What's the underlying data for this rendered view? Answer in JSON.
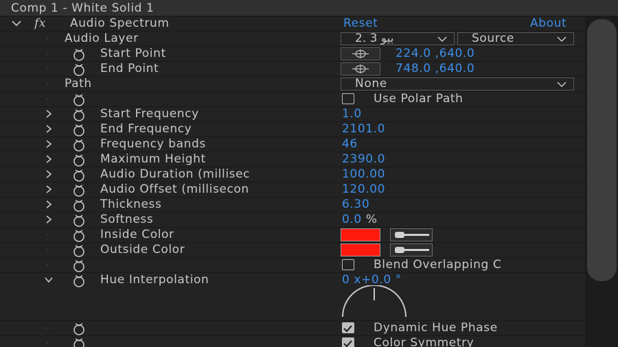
{
  "title": "Comp 1 - White Solid 1",
  "effect": {
    "name": "Audio Spectrum",
    "fx_icon": "fx",
    "reset": "Reset",
    "about": "About"
  },
  "rows": {
    "audio_layer": {
      "label": "Audio Layer",
      "value": "2. 3 بيو",
      "source": "Source"
    },
    "start_point": {
      "label": "Start Point",
      "value": "224.0 ,640.0"
    },
    "end_point": {
      "label": "End Point",
      "value": "748.0 ,640.0"
    },
    "path": {
      "label": "Path",
      "value": "None"
    },
    "use_polar": {
      "value": "Use Polar Path",
      "checked": false
    },
    "start_frequency": {
      "label": "Start Frequency",
      "value": "1.0"
    },
    "end_frequency": {
      "label": "End Frequency",
      "value": "2101.0"
    },
    "frequency_bands": {
      "label": "Frequency bands",
      "value": "46"
    },
    "maximum_height": {
      "label": "Maximum Height",
      "value": "2390.0"
    },
    "audio_duration": {
      "label": "Audio Duration (millisec",
      "value": "100.00"
    },
    "audio_offset": {
      "label": "Audio Offset (millisecon",
      "value": "120.00"
    },
    "thickness": {
      "label": "Thickness",
      "value": "6.30"
    },
    "softness": {
      "label": "Softness",
      "value": "0.0",
      "unit": "%"
    },
    "inside_color": {
      "label": "Inside Color",
      "color": "#ff1a0f"
    },
    "outside_color": {
      "label": "Outside Color",
      "color": "#ff1a0f"
    },
    "blend_overlapping": {
      "value": "Blend Overlapping C",
      "checked": false
    },
    "hue_interpolation": {
      "label": "Hue Interpolation",
      "value": "0 x+0.0 °"
    },
    "dynamic_hue": {
      "value": "Dynamic Hue Phase",
      "checked": true
    },
    "color_symmetry": {
      "value": "Color Symmetry",
      "checked": true
    }
  },
  "colors": {
    "accent": "#3d8fea",
    "background": "#232323",
    "swatch": "#ff1a0f"
  }
}
